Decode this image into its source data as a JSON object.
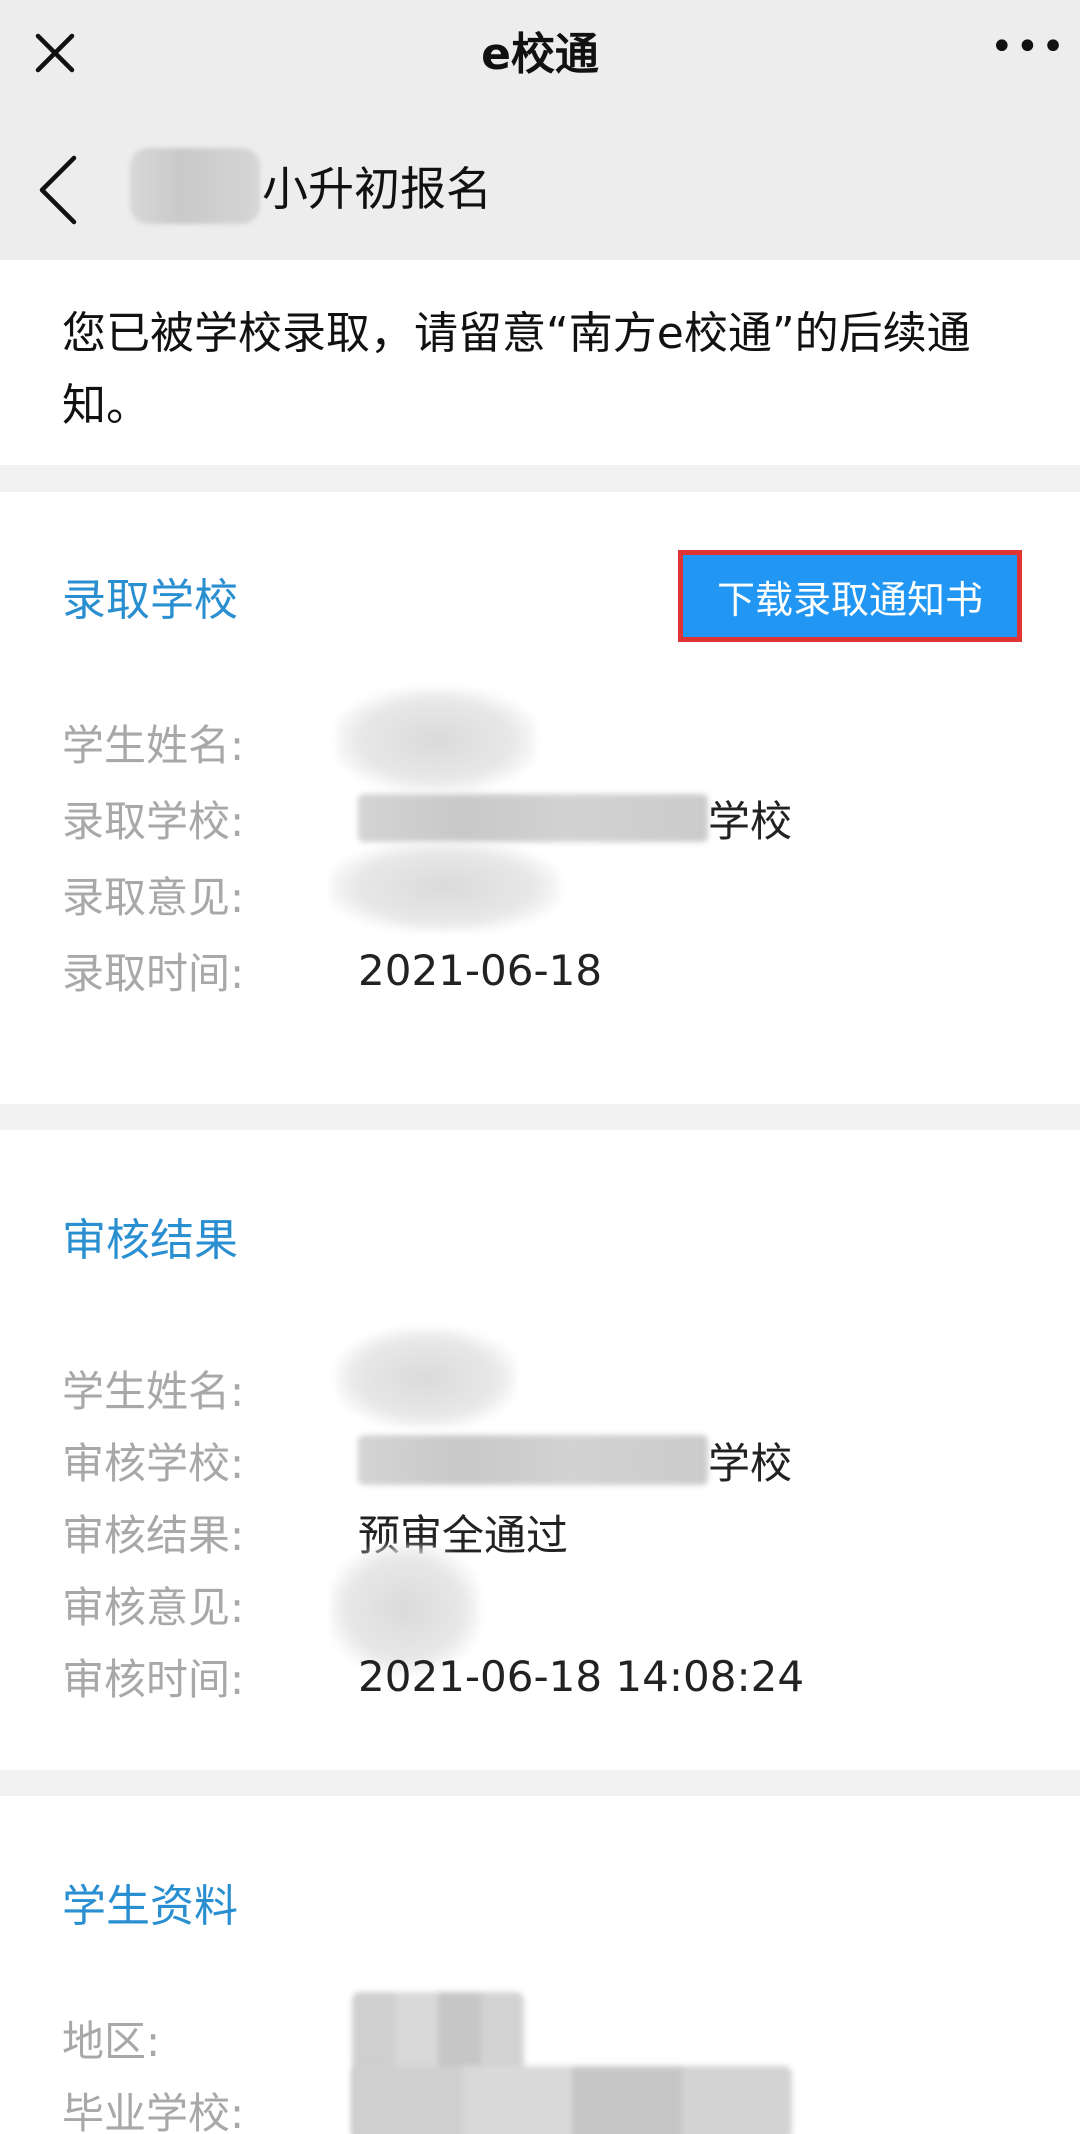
{
  "topbar": {
    "title": "e校通",
    "more_label": "•••"
  },
  "pagebar": {
    "title": "小升初报名"
  },
  "notice": {
    "text": "您已被学校录取，请留意“南方e校通”的后续通知。"
  },
  "admission": {
    "title": "录取学校",
    "download_label": "下载录取通知书",
    "rows": [
      {
        "label": "学生姓名:",
        "value": ""
      },
      {
        "label": "录取学校:",
        "value": "学校"
      },
      {
        "label": "录取意见:",
        "value": ""
      },
      {
        "label": "录取时间:",
        "value": "2021-06-18"
      }
    ]
  },
  "review": {
    "title": "审核结果",
    "rows": [
      {
        "label": "学生姓名:",
        "value": ""
      },
      {
        "label": "审核学校:",
        "value": "学校"
      },
      {
        "label": "审核结果:",
        "value": "预审全通过"
      },
      {
        "label": "审核意见:",
        "value": ""
      },
      {
        "label": "审核时间:",
        "value": "2021-06-18 14:08:24"
      }
    ]
  },
  "student": {
    "title": "学生资料",
    "rows": [
      {
        "label": "地区:",
        "value": ""
      },
      {
        "label": "毕业学校:",
        "value": ""
      }
    ]
  },
  "colors": {
    "accent": "#2a8fd1",
    "button_bg": "#2196f3",
    "highlight_border": "#e03434",
    "label_gray": "#a8a8a8"
  }
}
